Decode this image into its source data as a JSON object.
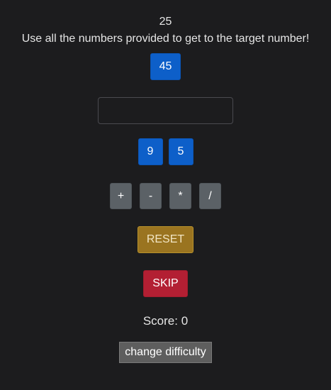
{
  "timer": "25",
  "instructions": "Use all the numbers provided to get to the target number!",
  "target": "45",
  "expression_input": {
    "value": "",
    "placeholder": ""
  },
  "numbers": [
    "9",
    "5"
  ],
  "operators": [
    "+",
    "-",
    "*",
    "/"
  ],
  "reset_label": "RESET",
  "skip_label": "SKIP",
  "score_text": "Score: 0",
  "difficulty_label": "change difficulty",
  "colors": {
    "background": "#1c1c1e",
    "primary": "#0d5fc9",
    "secondary": "#5b6166",
    "warning": "#9a7420",
    "danger": "#b31f33"
  }
}
